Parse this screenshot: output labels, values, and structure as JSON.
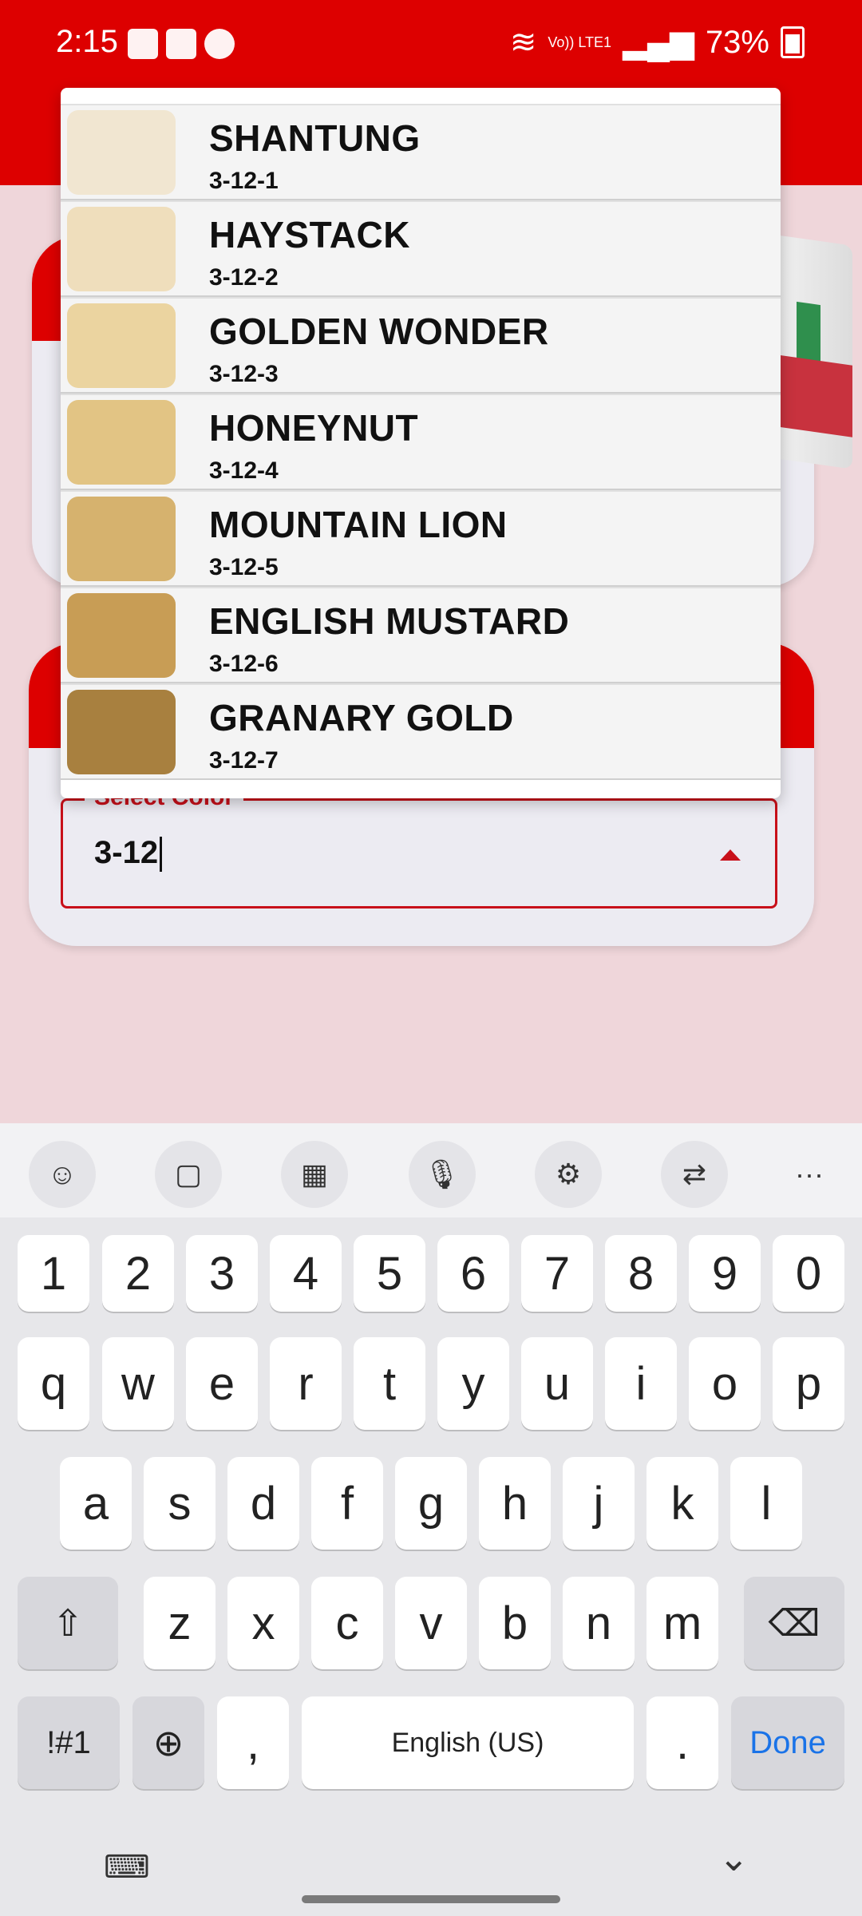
{
  "status_bar": {
    "time": "2:15",
    "network": "Vo)) LTE1",
    "battery": "73%"
  },
  "form": {
    "select_label": "Select Color",
    "select_value": "3-12"
  },
  "dropdown": {
    "items": [
      {
        "name": "SHANTUNG",
        "code": "3-12-1",
        "color": "#f1e6d1"
      },
      {
        "name": "HAYSTACK",
        "code": "3-12-2",
        "color": "#efdebc"
      },
      {
        "name": "GOLDEN WONDER",
        "code": "3-12-3",
        "color": "#ebd4a0"
      },
      {
        "name": "HONEYNUT",
        "code": "3-12-4",
        "color": "#e2c484"
      },
      {
        "name": "MOUNTAIN LION",
        "code": "3-12-5",
        "color": "#d6b26e"
      },
      {
        "name": "ENGLISH MUSTARD",
        "code": "3-12-6",
        "color": "#c89d55"
      },
      {
        "name": "GRANARY GOLD",
        "code": "3-12-7",
        "color": "#a8803f"
      }
    ]
  },
  "keyboard": {
    "toolbar_icons": [
      "emoji-icon",
      "clipboard-icon",
      "keypad-icon",
      "mic-icon",
      "settings-icon",
      "translate-icon",
      "more-icon"
    ],
    "row_numbers": [
      "1",
      "2",
      "3",
      "4",
      "5",
      "6",
      "7",
      "8",
      "9",
      "0"
    ],
    "row1": [
      "q",
      "w",
      "e",
      "r",
      "t",
      "y",
      "u",
      "i",
      "o",
      "p"
    ],
    "row2": [
      "a",
      "s",
      "d",
      "f",
      "g",
      "h",
      "j",
      "k",
      "l"
    ],
    "row3": [
      "z",
      "x",
      "c",
      "v",
      "b",
      "n",
      "m"
    ],
    "symbols_key": "!#1",
    "comma_key": ",",
    "space_key": "English (US)",
    "period_key": ".",
    "done_key": "Done"
  },
  "colors": {
    "brand_red": "#dd0000",
    "accent_blue": "#1a73e8"
  }
}
